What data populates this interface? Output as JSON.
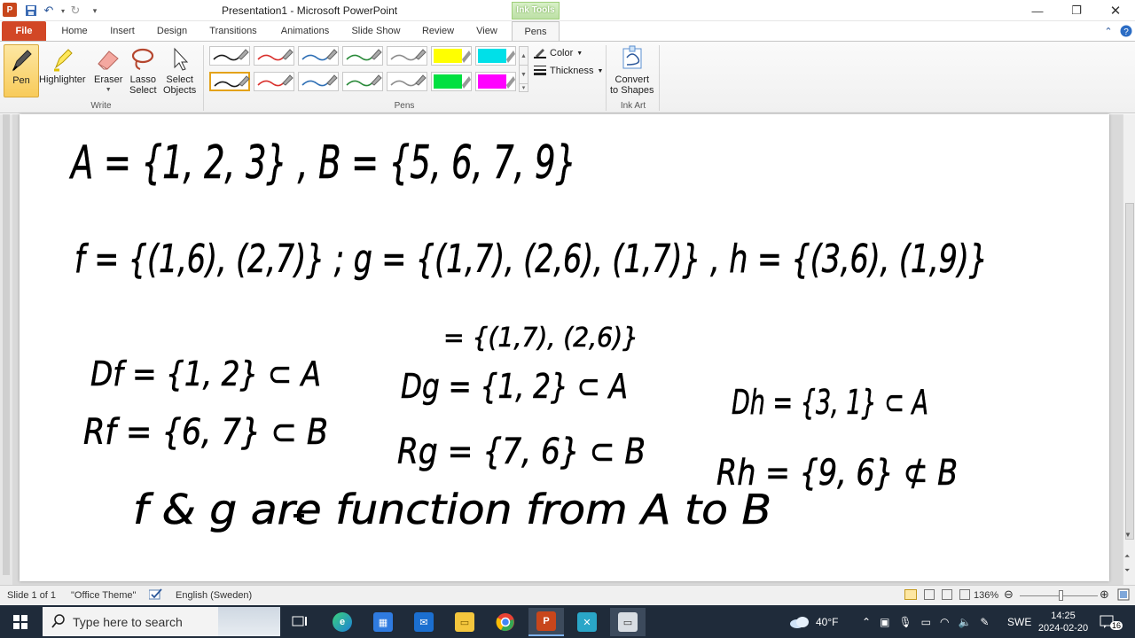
{
  "window": {
    "title": "Presentation1  -  Microsoft PowerPoint",
    "app_icon": "P",
    "contextual_tab_label": "Ink Tools",
    "controls": [
      "minimize",
      "restore",
      "close"
    ]
  },
  "tabs": [
    "File",
    "Home",
    "Insert",
    "Design",
    "Transitions",
    "Animations",
    "Slide Show",
    "Review",
    "View",
    "Pens"
  ],
  "ribbon": {
    "write_group": {
      "label": "Write",
      "buttons": [
        {
          "label": "Pen"
        },
        {
          "label": "Highlighter"
        },
        {
          "label": "Eraser"
        },
        {
          "label": "Lasso\nSelect",
          "line1": "Lasso",
          "line2": "Select"
        },
        {
          "label": "Select\nObjects",
          "line1": "Select",
          "line2": "Objects"
        }
      ]
    },
    "pens_group": {
      "label": "Pens",
      "pen_colors_row1": [
        "#1a1a1a",
        "#d9302c",
        "#2e6fb5",
        "#2a8a3a",
        "#8c8c8c",
        "#ffff00",
        "#00e0e8"
      ],
      "pen_colors_row2": [
        "#1a1a1a",
        "#d9302c",
        "#2e6fb5",
        "#2a8a3a",
        "#8c8c8c",
        "#00e040",
        "#ff00ff"
      ],
      "color_label": "Color",
      "thickness_label": "Thickness"
    },
    "ink_art_group": {
      "label": "Ink Art",
      "convert_line1": "Convert",
      "convert_line2": "to Shapes"
    }
  },
  "slide": {
    "handwriting": [
      "A = {1, 2, 3} , B = {5, 6, 7, 9}",
      "f = {(1,6), (2,7)} ; g = {(1,7), (2,6), (1,7)} , h = {(3,6), (1,9)}",
      "= {(1,7), (2,6)}",
      "Df = {1, 2} ⊂ A",
      "Dg = {1, 2} ⊂ A",
      "Dh = {3, 1} ⊂ A",
      "Rf = {6, 7} ⊂ B",
      "Rg = {7, 6} ⊂ B",
      "Rh = {9, 6} ⊄ B",
      "f & g are function from A to B"
    ]
  },
  "status": {
    "slide_indicator": "Slide 1 of 1",
    "theme": "\"Office Theme\"",
    "language": "English (Sweden)",
    "zoom": "136%"
  },
  "taskbar": {
    "search_placeholder": "Type here to search",
    "weather": "40°F",
    "language": "SWE",
    "time": "14:25",
    "date": "2024-02-20",
    "notifications": "16"
  }
}
